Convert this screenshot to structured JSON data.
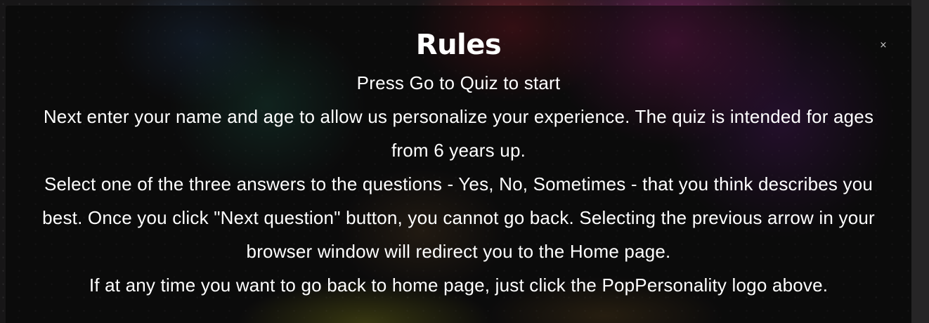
{
  "modal": {
    "title": "Rules",
    "close_label": "×",
    "lines": [
      "Press Go to Quiz to start",
      "Next enter your name and age to allow us personalize your experience. The quiz is intended for ages from 6 years up.",
      "Select one of the three answers to the questions - Yes, No, Sometimes - that you think describes you best. Once you click \"Next question\" button, you cannot go back. Selecting the previous arrow in your browser window will redirect you to the Home page.",
      "If at any time you want to go back to home page, just click the PopPersonality logo above."
    ]
  },
  "colors": {
    "text": "#ffffff",
    "close": "#c9c9c9",
    "overlay": "rgba(0,0,0,0.5)"
  },
  "icons": {
    "close": "close-icon"
  }
}
